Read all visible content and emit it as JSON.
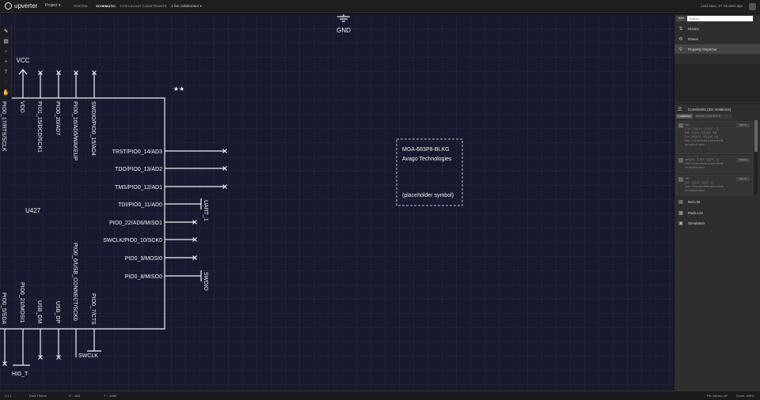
{
  "header": {
    "app_name": "upverter",
    "project_menu": "Project ▾",
    "tabs": [
      "SYSTEM",
      "SCHEMATIC",
      "PCB LAYOUT",
      "CONSTRAINTS"
    ],
    "active_tab": "SCHEMATIC",
    "collaborators": "1 live collaborator ▾",
    "last_save": "Last save: 17 minutes ago"
  },
  "toolbar": {
    "tools": [
      "select-tool",
      "grid-tool",
      "route-tool",
      "add-tool",
      "text-tool",
      "measure-tool",
      "pan-tool"
    ]
  },
  "schematic": {
    "gnd_label": "GND",
    "vcc_label": "VCC",
    "part_ref": "U427",
    "stars": "★★",
    "top_pins": [
      "PIO0_17/RTS/SCLK",
      "VDD",
      "PIO1_15/DCD/SCK1",
      "PIO0_20/AD7",
      "PIO0_16/AD5/WAKEUP",
      "SWDIO/PIO0_15/AD4"
    ],
    "right_pins": [
      "TRST/PIO0_14/AD3",
      "TDO/PIO0_13/AD2",
      "TMS/PIO0_12/AD1",
      "TDI/PIO0_11/AD0",
      "PIO0_22/AD6/MISO1",
      "SWCLK/PIO0_10/SCK0",
      "PIO0_9/MOSI0",
      "PIO0_8/MISO0"
    ],
    "bottom_pins": [
      "PIO0_5/SDA",
      "PIO0_21/MOSI1",
      "USB_DM",
      "USB_DP",
      "PIO0_6/USB_CONNECT/SCK0",
      "PIO0_7/CTS"
    ],
    "net_uart": "UART_1",
    "net_swdio": "SWDIO",
    "net_swclk": "SWCLK",
    "net_hid": "HID_T",
    "placeholder": {
      "part_number": "MGA-683P8-BLKG",
      "manufacturer": "Avago Technologies",
      "note": "(placeholder symbol)"
    }
  },
  "panel": {
    "search_button": "clear",
    "search_placeholder": "Search...",
    "items": [
      {
        "icon": "history-icon",
        "label": "History"
      },
      {
        "icon": "issues-icon",
        "label": "Issues"
      },
      {
        "icon": "magnifier-icon",
        "label": "Property Inspector"
      }
    ],
    "constraints_label": "Constraints (311 violations)",
    "customize_button": "Customize",
    "constraint_filter": "SHOW CONTENTS",
    "violations": [
      {
        "text": "Net\n[C13 - 1] [C14 - 1] [C17 - 1]\n[R8 - 1] [U4 - 31] [U4 - 48]\n[U4 - 49] [U4 - 41] [U4 - 40]\nhas > 3 connections and needs\nan explicit name",
        "button": "SHOW"
      },
      {
        "text": "Net [U3 - 1] [R1 - 1] [R9 - 1]\nhas > 3 connections and needs\nan explicit name",
        "button": "SHOW"
      },
      {
        "text": "Net\n[C3 - 1] [U4 - 16] [T - 1]\nhas > 3 connections and needs\nan explicit name",
        "button": "SHOW"
      }
    ],
    "bottom_items": [
      {
        "icon": "netlist-icon",
        "label": "Net List"
      },
      {
        "icon": "partslist-icon",
        "label": "Parts List"
      },
      {
        "icon": "simulation-icon",
        "label": "Simulation"
      }
    ]
  },
  "status": {
    "version": "2.1.1",
    "theme": "Dark Theme",
    "x_coord": "X : -468",
    "y_coord": "Y : -1460",
    "pin_names": "Pin names: off",
    "zoom": "Zoom: 200%"
  }
}
